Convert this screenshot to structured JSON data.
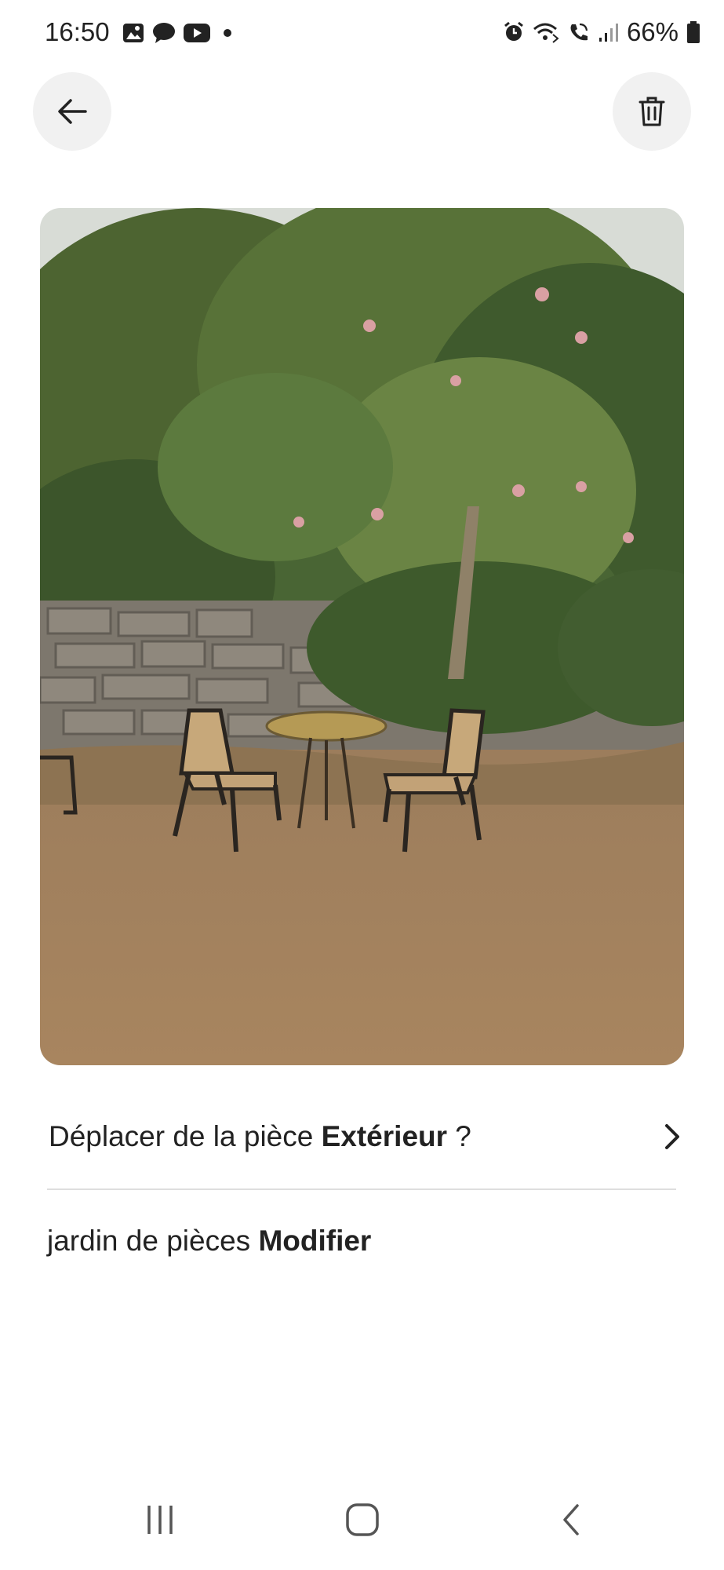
{
  "status_bar": {
    "time": "16:50",
    "battery": "66%",
    "left_icons": [
      "gallery-icon",
      "chat-icon",
      "youtube-icon",
      "dot-icon"
    ],
    "right_icons": [
      "alarm-icon",
      "wifi-calling-icon",
      "call-icon",
      "signal-icon",
      "battery-icon"
    ]
  },
  "header": {
    "back_icon": "arrow-left-icon",
    "delete_icon": "trash-icon"
  },
  "photo": {
    "description_icon": "garden-photo"
  },
  "move_row": {
    "prefix": "Déplacer de la pièce ",
    "room": "Extérieur",
    "suffix": " ?",
    "icon": "chevron-right-icon"
  },
  "room_row": {
    "prefix": "jardin de pièces ",
    "action": "Modifier"
  },
  "nav_bar": {
    "icons": [
      "recents-icon",
      "home-icon",
      "back-nav-icon"
    ]
  }
}
